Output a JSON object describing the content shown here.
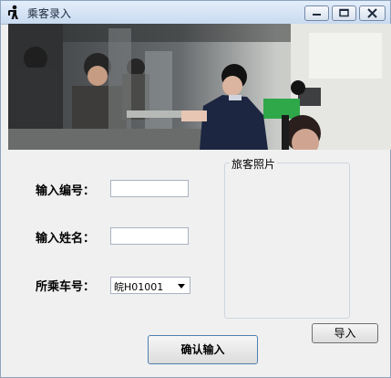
{
  "window": {
    "title": "乘客录入"
  },
  "form": {
    "id_label": "输入编号：",
    "id_value": "",
    "name_label": "输入姓名：",
    "name_value": "",
    "train_label": "所乘车号：",
    "train_selected": "皖H01001"
  },
  "photo_panel": {
    "label": "旅客照片"
  },
  "buttons": {
    "import_label": "导入",
    "confirm_label": "确认输入"
  }
}
